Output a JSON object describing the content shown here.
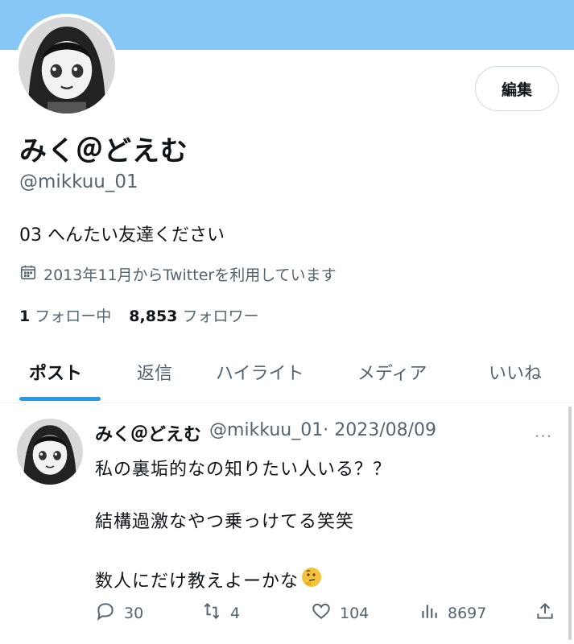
{
  "profile": {
    "display_name": "みく＠どえむ",
    "handle": "@mikkuu_01",
    "bio": "03 へんたい友達ください",
    "joined": "2013年11月からTwitterを利用しています",
    "following_count": "1",
    "following_label": "フォロー中",
    "followers_count": "8,853",
    "followers_label": "フォロワー",
    "edit_label": "編集"
  },
  "tabs": [
    {
      "label": "ポスト",
      "active": true
    },
    {
      "label": "返信"
    },
    {
      "label": "ハイライト"
    },
    {
      "label": "メディア"
    },
    {
      "label": "いいね"
    }
  ],
  "tweet": {
    "name": "みく＠どえむ",
    "handle": "@mikkuu_01",
    "date": "· 2023/08/09",
    "more": "···",
    "lines": [
      "私の裏垢的なの知りたい人いる？？",
      "結構過激なやつ乗っけてる笑笑",
      "数人にだけ教えよーかな"
    ],
    "emoji": "thinking-face",
    "replies": "30",
    "retweets": "4",
    "likes": "104",
    "views": "8697"
  },
  "colors": {
    "banner": "#86c7f5",
    "accent": "#1d9bf0",
    "text": "#0f1419",
    "secondary": "#536471"
  }
}
